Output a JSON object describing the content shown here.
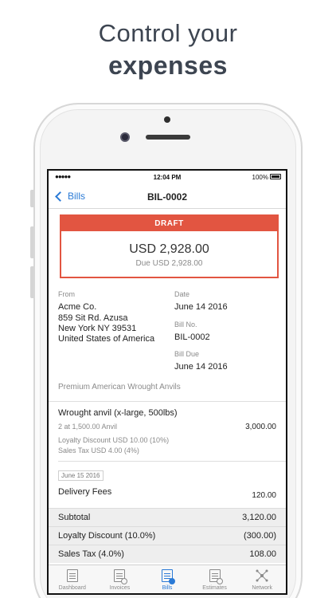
{
  "headline": {
    "line1": "Control your",
    "line2": "expenses"
  },
  "status_bar": {
    "signal": "●●●●●",
    "time": "12:04 PM",
    "battery": "100%"
  },
  "nav": {
    "back_label": "Bills",
    "title": "BIL-0002"
  },
  "bill_card": {
    "status": "DRAFT",
    "amount": "USD 2,928.00",
    "due": "Due USD 2,928.00"
  },
  "from": {
    "label": "From",
    "name": "Acme Co.",
    "address1": "859 Sit Rd. Azusa",
    "address2": "New York NY 39531",
    "country": "United States of America"
  },
  "date": {
    "label": "Date",
    "value": "June 14 2016"
  },
  "bill_no": {
    "label": "Bill No.",
    "value": "BIL-0002"
  },
  "bill_due": {
    "label": "Bill Due",
    "value": "June 14 2016"
  },
  "description": "Premium American Wrought Anvils",
  "line_item": {
    "title": "Wrought anvil (x-large, 500lbs)",
    "qty": "2 at 1,500.00 Anvil",
    "amount": "3,000.00",
    "discount": "Loyalty Discount USD 10.00 (10%)",
    "tax": "Sales Tax USD 4.00 (4%)"
  },
  "fees": {
    "date": "June 15 2016",
    "label": "Delivery Fees",
    "amount": "120.00"
  },
  "summary": [
    {
      "label": "Subtotal",
      "value": "3,120.00"
    },
    {
      "label": "Loyalty Discount (10.0%)",
      "value": "(300.00)"
    },
    {
      "label": "Sales Tax (4.0%)",
      "value": "108.00"
    }
  ],
  "tabs": [
    {
      "label": "Dashboard",
      "icon": "dashboard-icon",
      "active": false
    },
    {
      "label": "Invoices",
      "icon": "invoices-icon",
      "active": false
    },
    {
      "label": "Bills",
      "icon": "bills-icon",
      "active": true
    },
    {
      "label": "Estimates",
      "icon": "estimates-icon",
      "active": false
    },
    {
      "label": "Network",
      "icon": "network-icon",
      "active": false
    }
  ],
  "colors": {
    "accent": "#2a7ad6",
    "draft": "#e25541",
    "headline": "#3d4551"
  }
}
